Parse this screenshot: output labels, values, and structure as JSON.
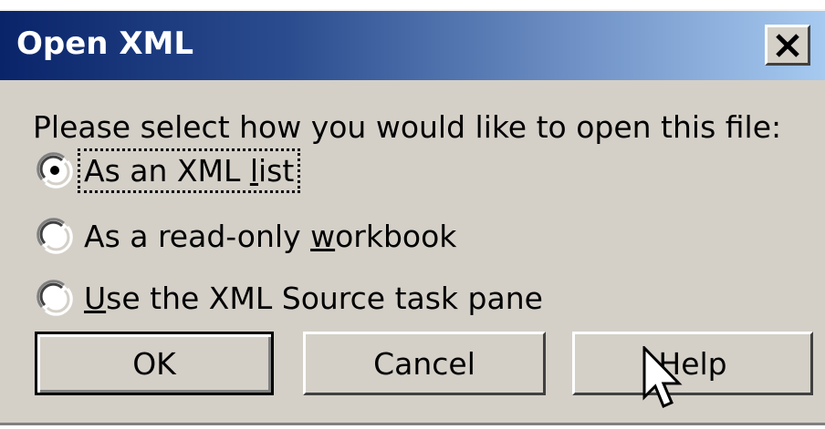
{
  "dialog": {
    "title": "Open XML",
    "close_glyph": "X",
    "prompt": "Please select how you would like to open this file:",
    "options": [
      {
        "label_pre": "",
        "label_ul": "",
        "label_post": "As an XML ",
        "label_ul2": "l",
        "label_post2": "ist",
        "selected": true
      },
      {
        "label_pre": "As a read-only ",
        "label_ul": "w",
        "label_post": "orkbook",
        "selected": false
      },
      {
        "label_pre": "",
        "label_ul": "U",
        "label_post": "se the XML Source task pane",
        "selected": false
      }
    ],
    "buttons": {
      "ok": "OK",
      "cancel": "Cancel",
      "help": "Help"
    }
  },
  "colors": {
    "face": "#d4d0c8",
    "title_start": "#0a246a",
    "title_end": "#a6caf0"
  },
  "icons": {
    "close": "close-icon",
    "radio_selected": "radio-selected-icon",
    "radio_unselected": "radio-unselected-icon",
    "cursor": "pointer-cursor-icon"
  }
}
